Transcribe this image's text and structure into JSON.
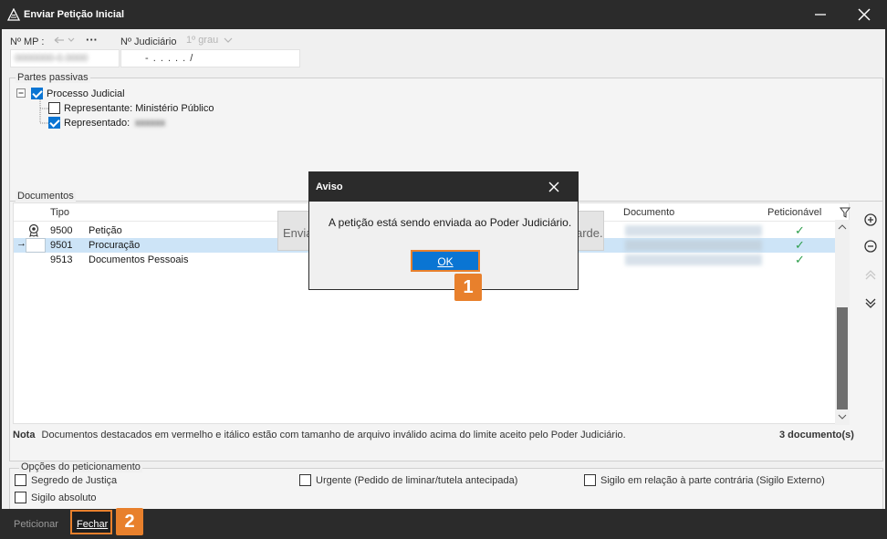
{
  "window": {
    "title": "Enviar Petição Inicial",
    "app_icon": "triangle-logo-icon"
  },
  "header": {
    "mp_label": "Nº MP :",
    "judicial_label": "Nº Judiciário",
    "instance": "1º grau",
    "judicial_value": "- . . . . . /"
  },
  "passive": {
    "legend": "Partes passivas",
    "root": "Processo Judicial",
    "rep_label": "Representante: Ministério Público",
    "represented_label": "Representado:"
  },
  "documents": {
    "legend": "Documentos",
    "col_tipo": "Tipo",
    "col_documento": "Documento",
    "col_peticionavel": "Peticionável",
    "rows": [
      {
        "code": "9500",
        "name": "Petição"
      },
      {
        "code": "9501",
        "name": "Procuração"
      },
      {
        "code": "9513",
        "name": "Documentos Pessoais"
      }
    ],
    "note_bold": "Nota",
    "note": "Documentos destacados em vermelho e itálico estão com tamanho de arquivo inválido acima do limite aceito pelo Poder Judiciário.",
    "count": "3 documento(s)"
  },
  "options": {
    "legend": "Opções do peticionamento",
    "secret": "Segredo de Justiça",
    "urgent": "Urgente (Pedido de liminar/tutela antecipada)",
    "external": "Sigilo em relação à parte contrária (Sigilo Externo)",
    "absolute": "Sigilo absoluto"
  },
  "footer": {
    "petition": "Peticionar",
    "close": "Fechar"
  },
  "overlay": {
    "left_text": "Envia",
    "right_text": "arde."
  },
  "dialog": {
    "title": "Aviso",
    "message": "A petição está sendo enviada ao Poder Judiciário.",
    "ok": "OK"
  },
  "badges": {
    "one": "1",
    "two": "2"
  },
  "colors": {
    "accent": "#0a75d3",
    "badge": "#e8802c",
    "titlebar": "#2b2b2b",
    "check": "#2e9e4c"
  }
}
